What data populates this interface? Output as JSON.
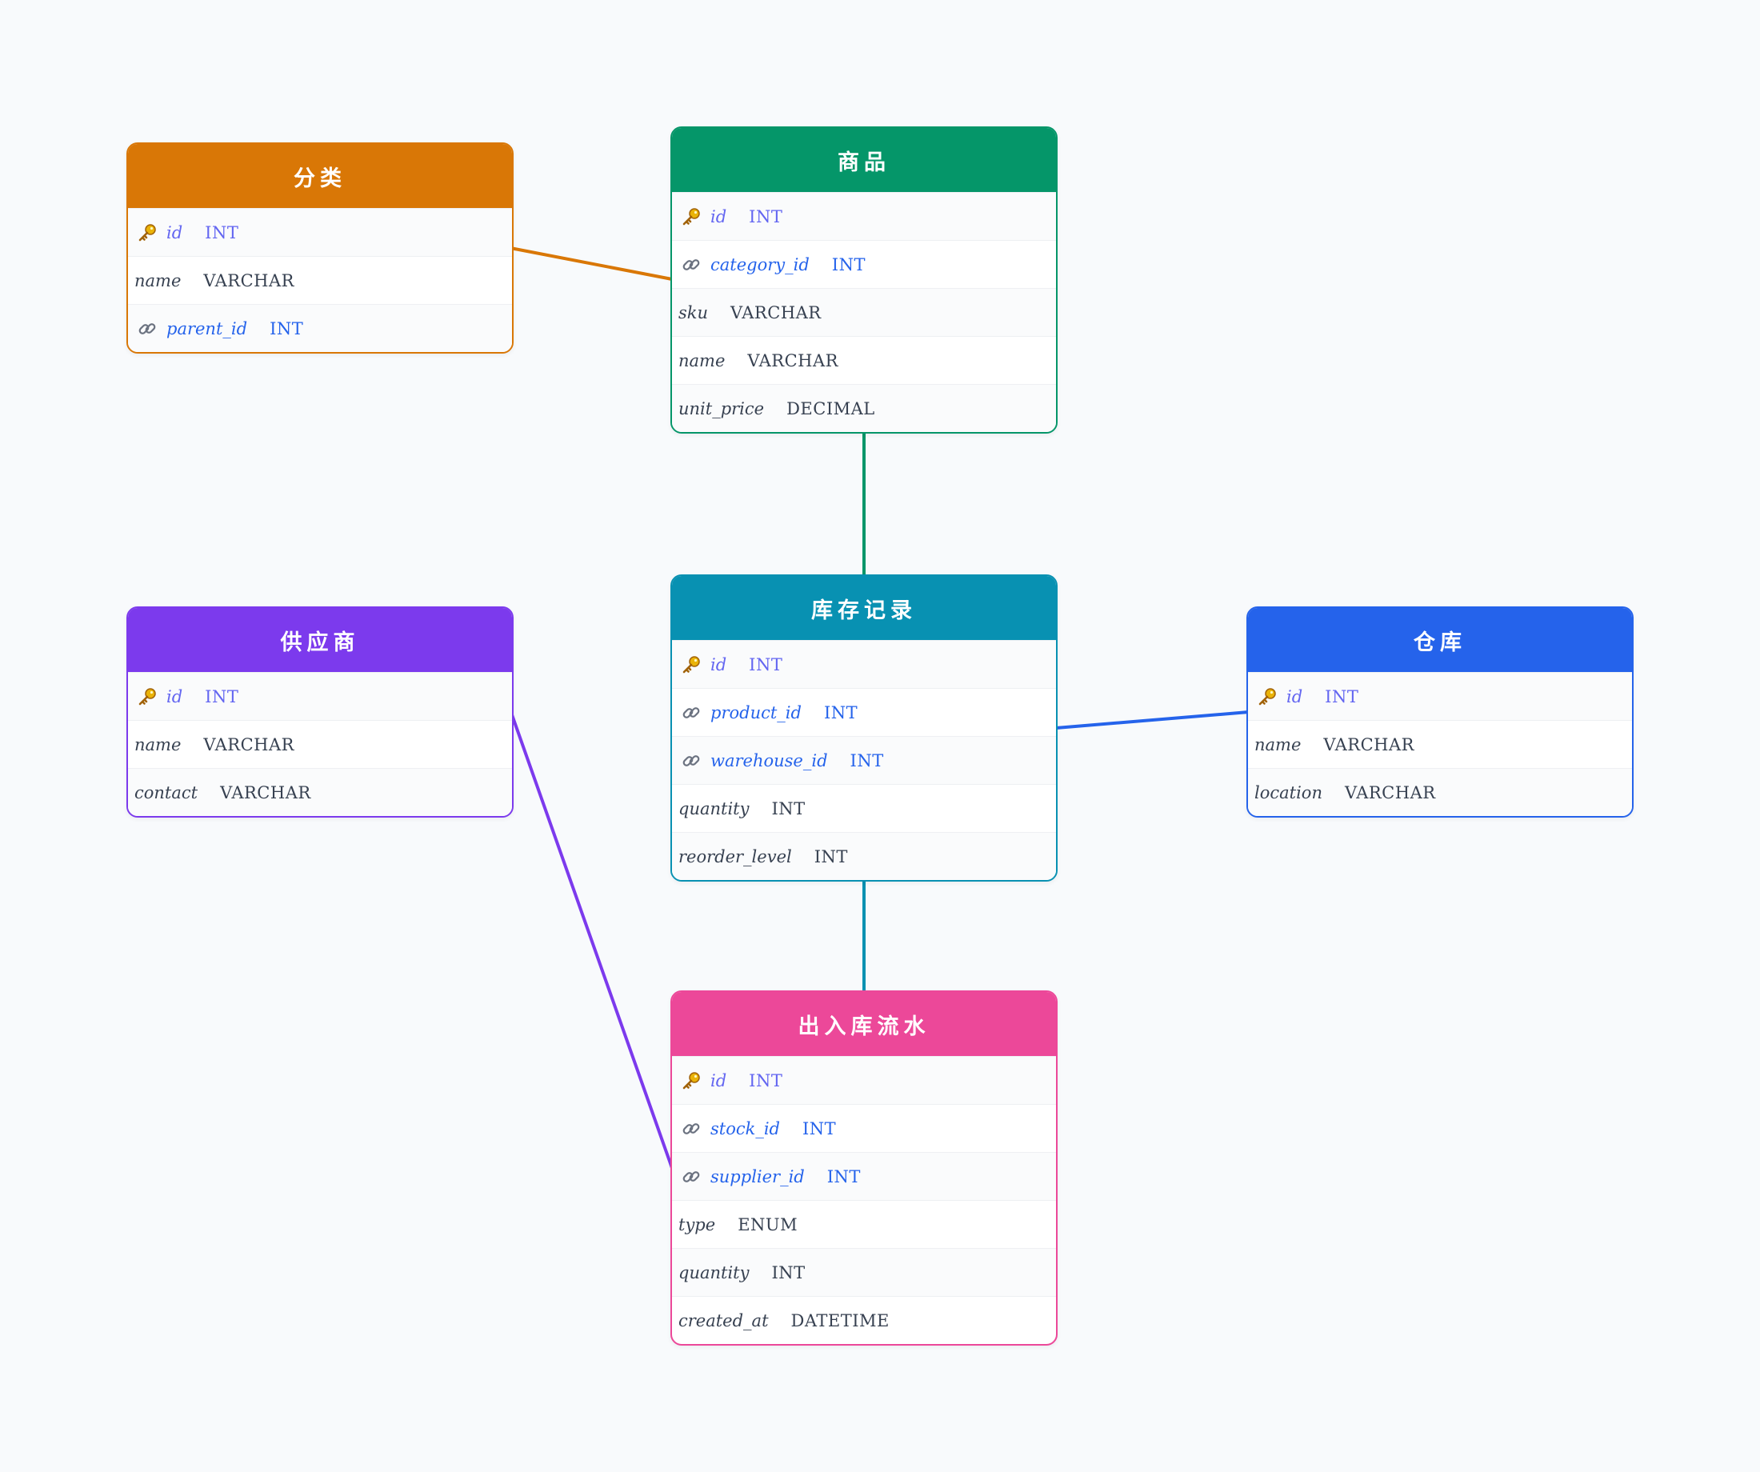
{
  "colors": {
    "category": "#d97706",
    "product": "#059669",
    "stock": "#0891b2",
    "supplier": "#7c3aed",
    "warehouse": "#2563eb",
    "movement": "#ec4899",
    "pk_text": "#6366f1",
    "fk_text": "#2563eb"
  },
  "tables": {
    "category": {
      "title": "分类",
      "rows": [
        {
          "name": "id",
          "type": "INT",
          "kind": "pk",
          "icon": "key-icon"
        },
        {
          "name": "name",
          "type": "VARCHAR",
          "kind": "field"
        },
        {
          "name": "parent_id",
          "type": "INT",
          "kind": "fk",
          "icon": "link-icon"
        }
      ]
    },
    "product": {
      "title": "商品",
      "rows": [
        {
          "name": "id",
          "type": "INT",
          "kind": "pk",
          "icon": "key-icon"
        },
        {
          "name": "category_id",
          "type": "INT",
          "kind": "fk",
          "icon": "link-icon"
        },
        {
          "name": "sku",
          "type": "VARCHAR",
          "kind": "field"
        },
        {
          "name": "name",
          "type": "VARCHAR",
          "kind": "field"
        },
        {
          "name": "unit_price",
          "type": "DECIMAL",
          "kind": "field"
        }
      ]
    },
    "stock": {
      "title": "库存记录",
      "rows": [
        {
          "name": "id",
          "type": "INT",
          "kind": "pk",
          "icon": "key-icon"
        },
        {
          "name": "product_id",
          "type": "INT",
          "kind": "fk",
          "icon": "link-icon"
        },
        {
          "name": "warehouse_id",
          "type": "INT",
          "kind": "fk",
          "icon": "link-icon"
        },
        {
          "name": "quantity",
          "type": "INT",
          "kind": "field"
        },
        {
          "name": "reorder_level",
          "type": "INT",
          "kind": "field"
        }
      ]
    },
    "supplier": {
      "title": "供应商",
      "rows": [
        {
          "name": "id",
          "type": "INT",
          "kind": "pk",
          "icon": "key-icon"
        },
        {
          "name": "name",
          "type": "VARCHAR",
          "kind": "field"
        },
        {
          "name": "contact",
          "type": "VARCHAR",
          "kind": "field"
        }
      ]
    },
    "warehouse": {
      "title": "仓库",
      "rows": [
        {
          "name": "id",
          "type": "INT",
          "kind": "pk",
          "icon": "key-icon"
        },
        {
          "name": "name",
          "type": "VARCHAR",
          "kind": "field"
        },
        {
          "name": "location",
          "type": "VARCHAR",
          "kind": "field"
        }
      ]
    },
    "movement": {
      "title": "出入库流水",
      "rows": [
        {
          "name": "id",
          "type": "INT",
          "kind": "pk",
          "icon": "key-icon"
        },
        {
          "name": "stock_id",
          "type": "INT",
          "kind": "fk",
          "icon": "link-icon"
        },
        {
          "name": "supplier_id",
          "type": "INT",
          "kind": "fk",
          "icon": "link-icon"
        },
        {
          "name": "type",
          "type": "ENUM",
          "kind": "field"
        },
        {
          "name": "quantity",
          "type": "INT",
          "kind": "field"
        },
        {
          "name": "created_at",
          "type": "DATETIME",
          "kind": "field"
        }
      ]
    }
  },
  "relations": [
    {
      "from": "category",
      "to": "product",
      "color": "#d97706"
    },
    {
      "from": "product",
      "to": "stock",
      "color": "#059669"
    },
    {
      "from": "warehouse",
      "to": "stock",
      "color": "#2563eb"
    },
    {
      "from": "stock",
      "to": "movement",
      "color": "#0891b2"
    },
    {
      "from": "supplier",
      "to": "movement",
      "color": "#7c3aed"
    }
  ]
}
